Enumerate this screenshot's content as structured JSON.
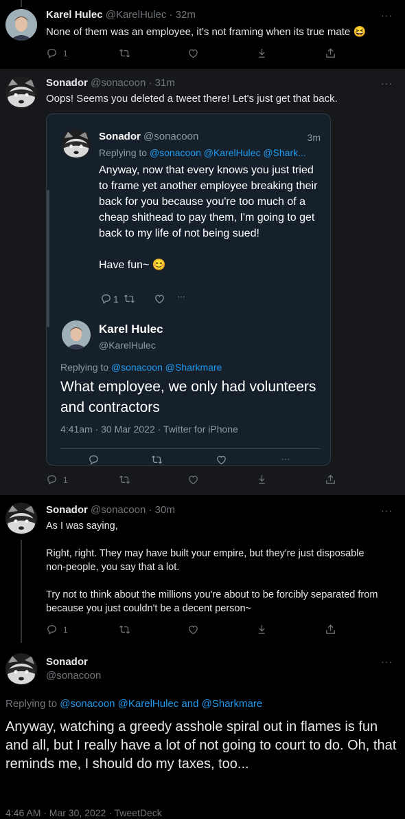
{
  "tweets": [
    {
      "name": "Karel Hulec",
      "handle": "@KarelHulec",
      "time": "32m",
      "text": "None of them was an employee, it’s not framing when its true mate 😆",
      "reply_count": "1",
      "more": "···"
    },
    {
      "name": "Sonador",
      "handle": "@sonacoon",
      "time": "31m",
      "text": "Oops! Seems you deleted a tweet there! Let's just get that back.",
      "reply_count": "1",
      "more": "···"
    },
    {
      "name": "Sonador",
      "handle": "@sonacoon",
      "time": "30m",
      "text": "As I was saying,\n\nRight, right. They may have built your empire, but they're just disposable non-people, you say that a lot.\n\nTry not to think about the millions you're about to be forcibly separated from because you just couldn't be a decent person~",
      "reply_count": "1",
      "more": "···"
    }
  ],
  "screenshot": {
    "name": "Sonador",
    "handle": "@sonacoon",
    "time": "3m",
    "replying_prefix": "Replying to",
    "replying_to": "@sonacoon @KarelHulec @Shark...",
    "text": "Anyway, now that every knows you just tried to frame yet another employee breaking their back for you because you're too much of a cheap shithead to pay them, I'm going to get back to my life of not being sued!\n\nHave fun~ 😊",
    "reply_count": "1",
    "more": "···",
    "quoted": {
      "name": "Karel Hulec",
      "handle": "@KarelHulec",
      "replying_prefix": "Replying to",
      "replying_to": "@sonacoon @Sharkmare",
      "text": "What employee, we only had volunteers and contractors",
      "meta": "4:41am · 30 Mar 2022 · Twitter for iPhone"
    }
  },
  "main_tweet": {
    "name": "Sonador",
    "handle": "@sonacoon",
    "more": "···",
    "replying_prefix": "Replying to",
    "replying_to": "@sonacoon @KarelHulec and @Sharkmare",
    "text": "Anyway, watching a greedy asshole spiral out in flames is fun and all, but I really have a lot of not going to court to do. Oh, that reminds me, I should do my taxes, too...",
    "meta": "4:46 AM · Mar 30, 2022 · TweetDeck"
  },
  "colors": {
    "background": "#000000",
    "highlight": "#16181c",
    "link": "#1d9bf0",
    "muted": "#71767b",
    "screenshot_bg": "#15202b"
  }
}
